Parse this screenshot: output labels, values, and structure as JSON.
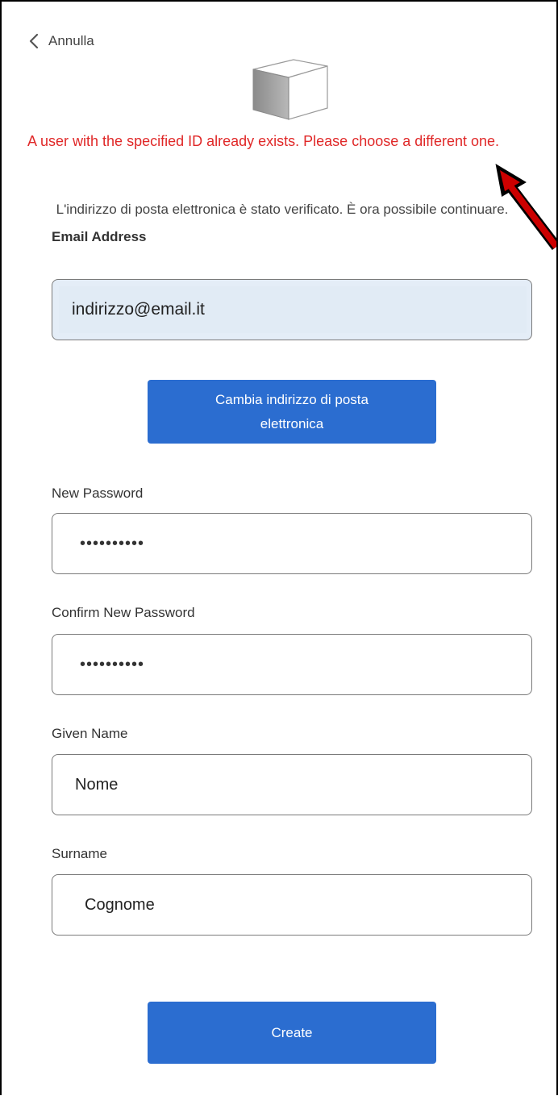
{
  "back": {
    "label": "Annulla"
  },
  "error": {
    "message": "A user with the specified ID already exists. Please choose a different one."
  },
  "verified": {
    "message": "L'indirizzo di posta elettronica è stato verificato. È ora possibile continuare."
  },
  "email": {
    "label": "Email Address",
    "value": "indirizzo@email.it"
  },
  "change_email": {
    "label_line1": "Cambia indirizzo di posta",
    "label_line2": "elettronica"
  },
  "new_password": {
    "label": "New Password",
    "masked_value": "••••••••••"
  },
  "confirm_password": {
    "label": "Confirm New Password",
    "masked_value": "••••••••••"
  },
  "given_name": {
    "label": "Given Name",
    "value": "Nome"
  },
  "surname": {
    "label": "Surname",
    "value": "Cognome"
  },
  "create": {
    "label": "Create"
  },
  "colors": {
    "error": "#e02828",
    "button": "#2b6dd0",
    "email_fill": "#e1ebf5",
    "annotation_arrow": "#cc0000"
  },
  "icons": [
    "chevron-left-icon",
    "cube-logo-icon",
    "annotation-arrow-icon"
  ]
}
